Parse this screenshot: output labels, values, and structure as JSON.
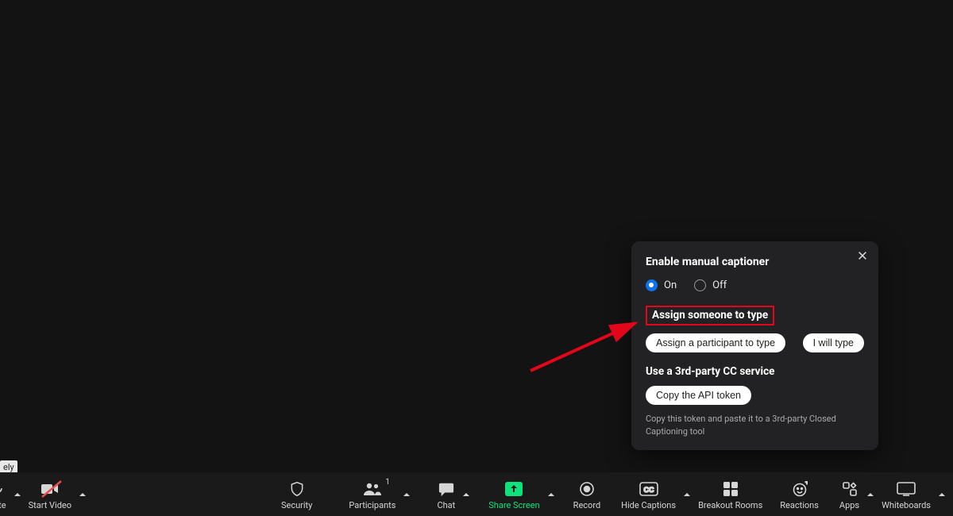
{
  "stray_tooltip": "ely",
  "toolbar": {
    "mute": {
      "label": "nute"
    },
    "start_video": {
      "label": "Start Video"
    },
    "security": {
      "label": "Security"
    },
    "participants": {
      "label": "Participants",
      "count": "1"
    },
    "chat": {
      "label": "Chat"
    },
    "share_screen": {
      "label": "Share Screen"
    },
    "record": {
      "label": "Record"
    },
    "hide_captions": {
      "label": "Hide Captions"
    },
    "breakout_rooms": {
      "label": "Breakout Rooms"
    },
    "reactions": {
      "label": "Reactions"
    },
    "apps": {
      "label": "Apps"
    },
    "whiteboards": {
      "label": "Whiteboards"
    }
  },
  "popover": {
    "title": "Enable manual captioner",
    "option_on": "On",
    "option_off": "Off",
    "assign_heading": "Assign someone to type",
    "assign_participant_btn": "Assign a participant to type",
    "i_will_type_btn": "I will type",
    "third_party_heading": "Use a 3rd-party CC service",
    "copy_token_btn": "Copy the API token",
    "help_text": "Copy this token and paste it to a 3rd-party Closed Captioning tool"
  },
  "annotation": {
    "highlight_target": "Assign someone to type"
  }
}
